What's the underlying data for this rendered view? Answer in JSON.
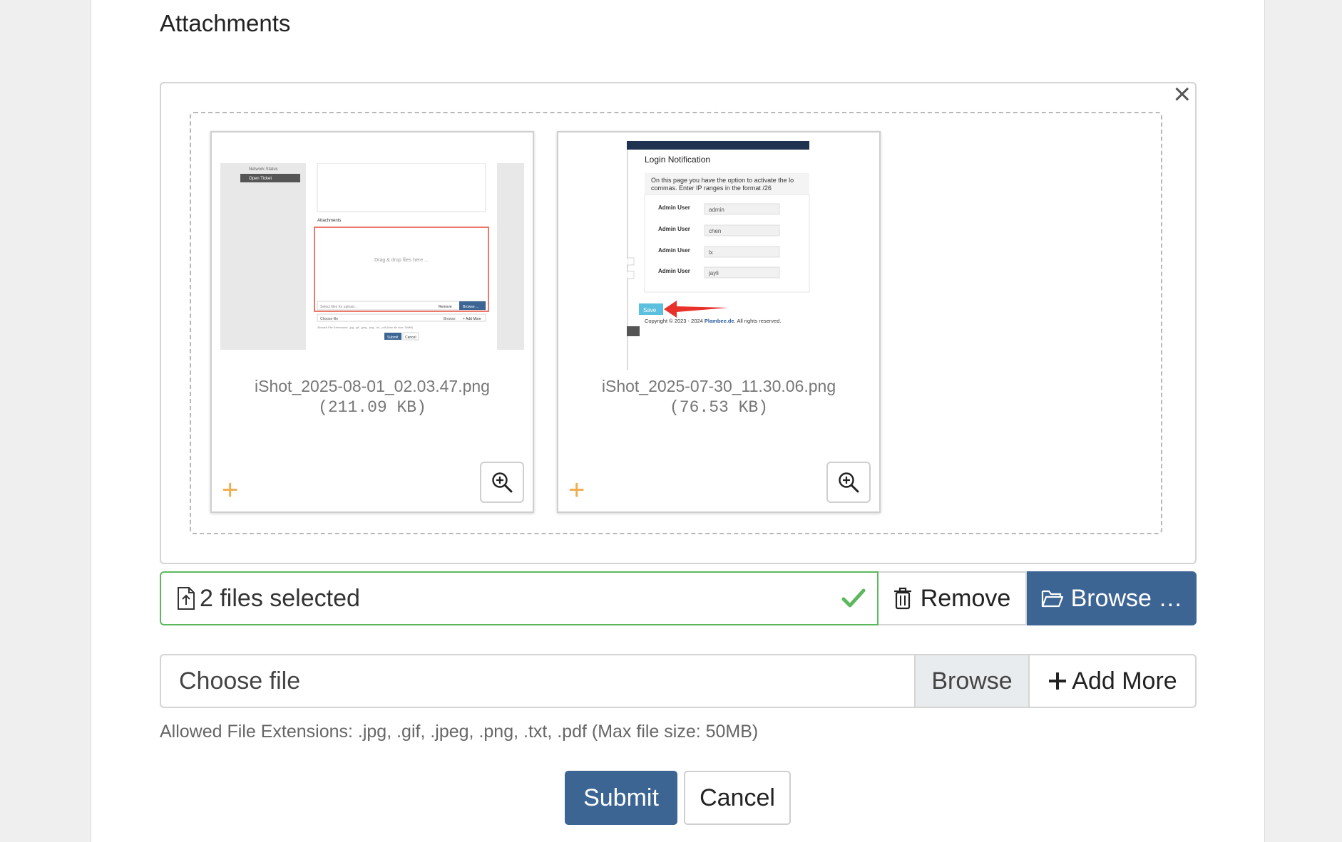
{
  "section": {
    "title": "Attachments"
  },
  "preview": {
    "files": [
      {
        "name": "iShot_2025-08-01_02.03.47.png",
        "size": "(211.09 KB)"
      },
      {
        "name": "iShot_2025-07-30_11.30.06.png",
        "size": "(76.53 KB)"
      }
    ],
    "thumb1": {
      "sidebar_items": [
        "Network Status",
        "Open Ticket"
      ],
      "section_label": "Attachments",
      "drop_text": "Drag & drop files here ...",
      "caption_placeholder": "Select files for upload...",
      "remove_label": "Remove",
      "browse_label": "Browse ...",
      "choose_label": "Choose file",
      "choose_browse": "Browse",
      "add_more": "+ Add More",
      "help": "Allowed File Extensions: .jpg, .gif, .jpeg, .png, .txt, .pdf (Max file size: 50MB)",
      "submit": "Submit",
      "cancel": "Cancel"
    },
    "thumb2": {
      "title": "Login Notification",
      "desc_line1": "On this page you have the option to activate the lo",
      "desc_line2": "commas. Enter IP ranges in the format /26",
      "rows": [
        {
          "label": "Admin User",
          "value": "admin"
        },
        {
          "label": "Admin User",
          "value": "chen"
        },
        {
          "label": "Admin User",
          "value": "lx"
        },
        {
          "label": "Admin User",
          "value": "jayli"
        }
      ],
      "save": "Save",
      "copyright_prefix": "Copyright © 2023 - 2024 ",
      "copyright_brand": "Plambee.de",
      "copyright_suffix": ". All rights reserved."
    }
  },
  "caption": {
    "text": "2 files selected"
  },
  "actions": {
    "remove_label": "Remove",
    "browse_label": "Browse …"
  },
  "choose": {
    "label": "Choose file",
    "browse_label": "Browse",
    "add_more_label": "Add More"
  },
  "help_text": "Allowed File Extensions: .jpg, .gif, .jpeg, .png, .txt, .pdf (Max file size: 50MB)",
  "form": {
    "submit_label": "Submit",
    "cancel_label": "Cancel"
  },
  "colors": {
    "primary": "#3d6594",
    "success": "#5cb85c",
    "plus": "#f0ad4e",
    "arrow": "#e8312a"
  }
}
